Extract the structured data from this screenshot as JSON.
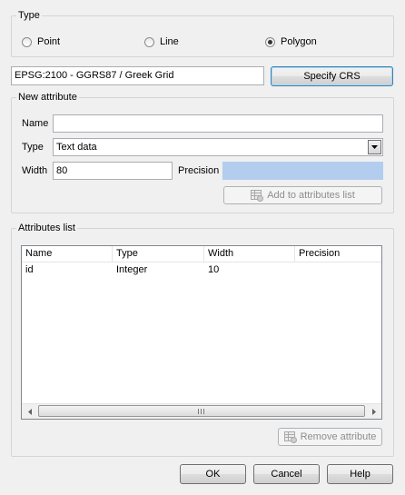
{
  "geometry": {
    "title": "Type",
    "options": [
      {
        "label": "Point",
        "checked": false
      },
      {
        "label": "Line",
        "checked": false
      },
      {
        "label": "Polygon",
        "checked": true
      }
    ]
  },
  "crs": {
    "value": "EPSG:2100 - GGRS87 / Greek Grid",
    "button_label": "Specify CRS"
  },
  "new_attribute": {
    "title": "New attribute",
    "name_label": "Name",
    "name_value": "",
    "type_label": "Type",
    "type_value": "Text data",
    "width_label": "Width",
    "width_value": "80",
    "precision_label": "Precision",
    "precision_value": "",
    "add_button_label": "Add to attributes list"
  },
  "attributes_list": {
    "title": "Attributes list",
    "columns": [
      "Name",
      "Type",
      "Width",
      "Precision"
    ],
    "rows": [
      {
        "name": "id",
        "type": "Integer",
        "width": "10",
        "precision": ""
      }
    ],
    "remove_button_label": "Remove attribute"
  },
  "dialog_buttons": {
    "ok": "OK",
    "cancel": "Cancel",
    "help": "Help"
  }
}
